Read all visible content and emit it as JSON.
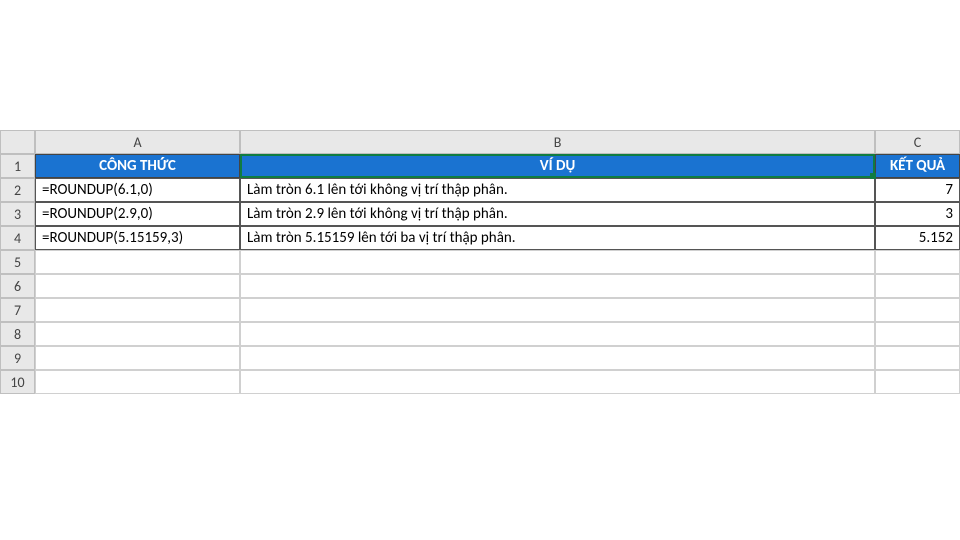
{
  "columns": [
    "A",
    "B",
    "C"
  ],
  "row_numbers": [
    "1",
    "2",
    "3",
    "4",
    "5",
    "6",
    "7",
    "8",
    "9",
    "10"
  ],
  "header_row": {
    "a": "CÔNG THỨC",
    "b": "VÍ DỤ",
    "c": "KẾT QUẢ"
  },
  "data_rows": [
    {
      "a": "=ROUNDUP(6.1,0)",
      "b": "Làm tròn 6.1 lên tới không vị trí thập phân.",
      "c": "7"
    },
    {
      "a": "=ROUNDUP(2.9,0)",
      "b": "Làm tròn 2.9 lên tới không vị trí thập phân.",
      "c": "3"
    },
    {
      "a": "=ROUNDUP(5.15159,3)",
      "b": "Làm tròn 5.15159 lên tới ba vị trí thập phân.",
      "c": "5.152"
    }
  ]
}
